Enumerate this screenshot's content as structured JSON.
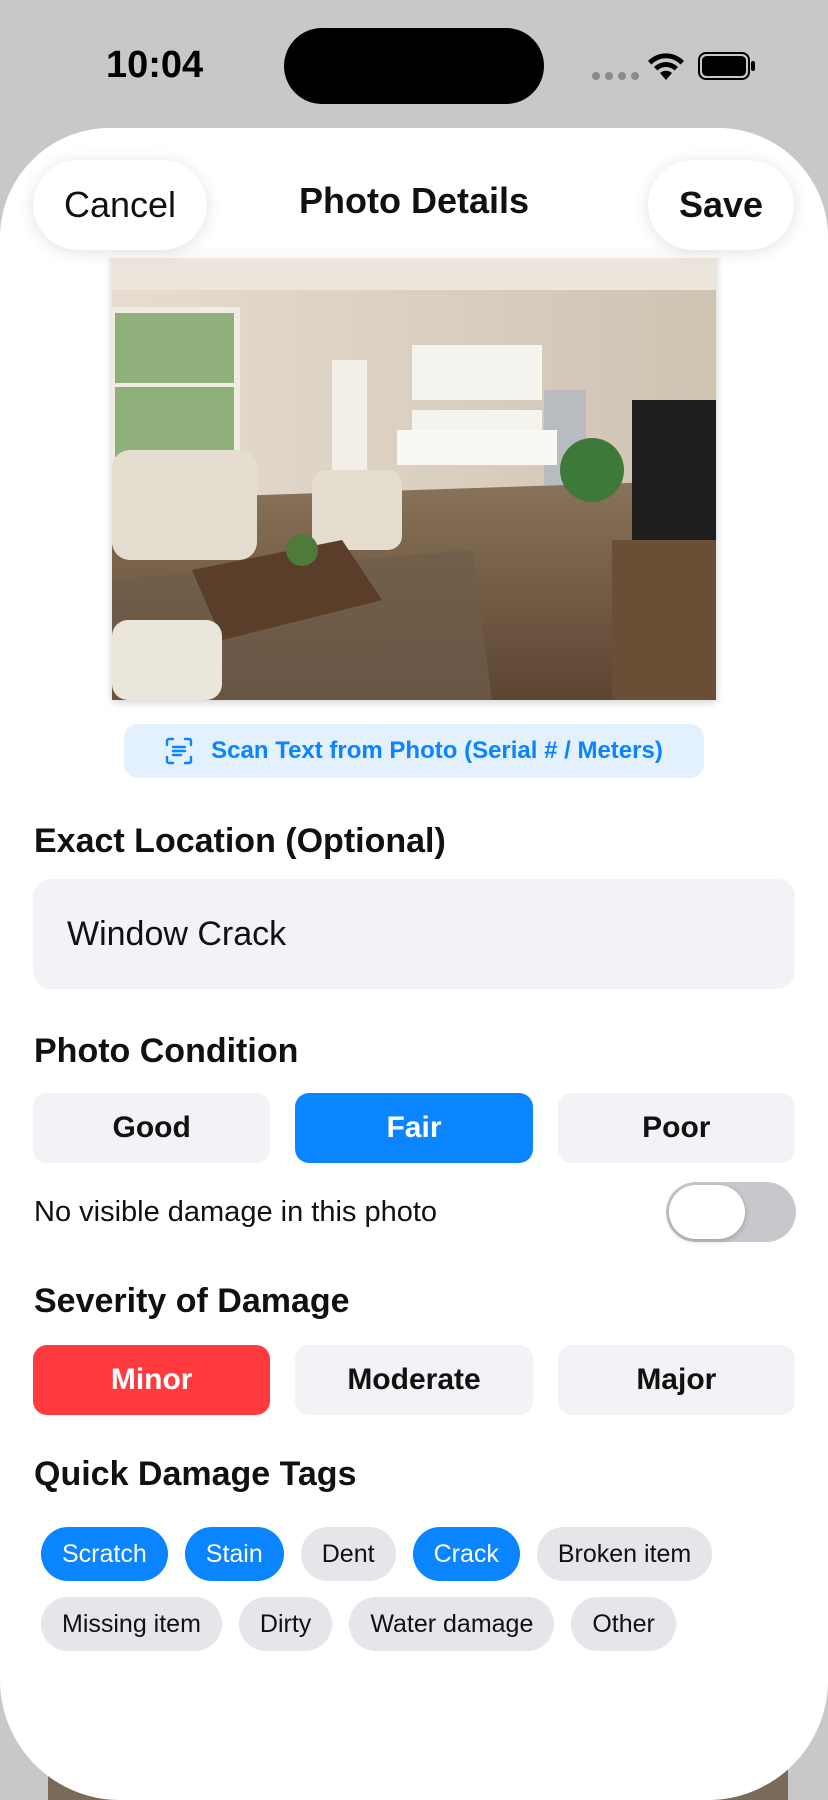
{
  "status_bar": {
    "time": "10:04"
  },
  "header": {
    "cancel_label": "Cancel",
    "title": "Photo Details",
    "save_label": "Save"
  },
  "photo": {
    "description_icon": "photo-thumbnail"
  },
  "scan": {
    "label": "Scan Text from Photo (Serial # / Meters)",
    "icon": "text-scan-icon"
  },
  "location": {
    "label": "Exact Location (Optional)",
    "value": "Window Crack"
  },
  "condition": {
    "label": "Photo Condition",
    "options": [
      "Good",
      "Fair",
      "Poor"
    ],
    "selected": "Fair"
  },
  "no_damage": {
    "label": "No visible damage in this photo",
    "on": false
  },
  "severity": {
    "label": "Severity of Damage",
    "options": [
      "Minor",
      "Moderate",
      "Major"
    ],
    "selected": "Minor"
  },
  "tags": {
    "label": "Quick Damage Tags",
    "items": [
      {
        "label": "Scratch",
        "selected": true
      },
      {
        "label": "Stain",
        "selected": true
      },
      {
        "label": "Dent",
        "selected": false
      },
      {
        "label": "Crack",
        "selected": true
      },
      {
        "label": "Broken item",
        "selected": false
      },
      {
        "label": "Missing item",
        "selected": false
      },
      {
        "label": "Dirty",
        "selected": false
      },
      {
        "label": "Water damage",
        "selected": false
      },
      {
        "label": "Other",
        "selected": false
      }
    ]
  },
  "colors": {
    "accent": "#0a84ff",
    "danger": "#ff3b3f",
    "field_bg": "#f2f2f7"
  }
}
